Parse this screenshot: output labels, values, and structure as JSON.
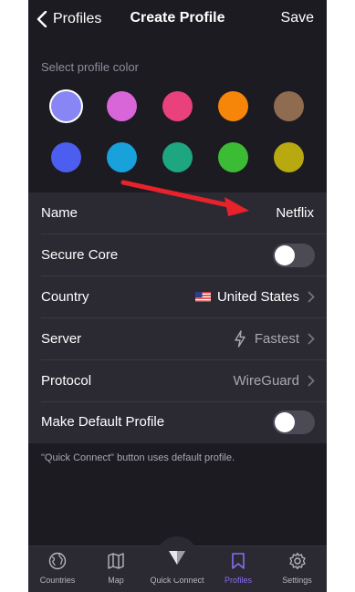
{
  "nav": {
    "back_label": "Profiles",
    "title": "Create Profile",
    "save_label": "Save"
  },
  "colors": {
    "label": "Select profile color",
    "swatches": [
      "#8786f4",
      "#d966d8",
      "#e8417b",
      "#f5860a",
      "#8f6b50",
      "#4b5ef0",
      "#18a1db",
      "#1ea680",
      "#3cbc34",
      "#b9a911"
    ],
    "selected_index": 0
  },
  "form": {
    "name": {
      "label": "Name",
      "value": "Netflix"
    },
    "secure_core": {
      "label": "Secure Core",
      "enabled": false
    },
    "country": {
      "label": "Country",
      "value": "United States",
      "flag_icon": "us-flag-icon"
    },
    "server": {
      "label": "Server",
      "value": "Fastest",
      "icon": "bolt-icon"
    },
    "protocol": {
      "label": "Protocol",
      "value": "WireGuard"
    },
    "default_profile": {
      "label": "Make Default Profile",
      "enabled": false
    }
  },
  "footnote": "\"Quick Connect\" button uses default profile.",
  "annotation": {
    "arrow_color": "#e8222b"
  },
  "tabbar": {
    "countries": "Countries",
    "map": "Map",
    "quick_connect": "Quick Connect",
    "profiles": "Profiles",
    "settings": "Settings",
    "active": "profiles",
    "accent": "#8a6cf0"
  }
}
